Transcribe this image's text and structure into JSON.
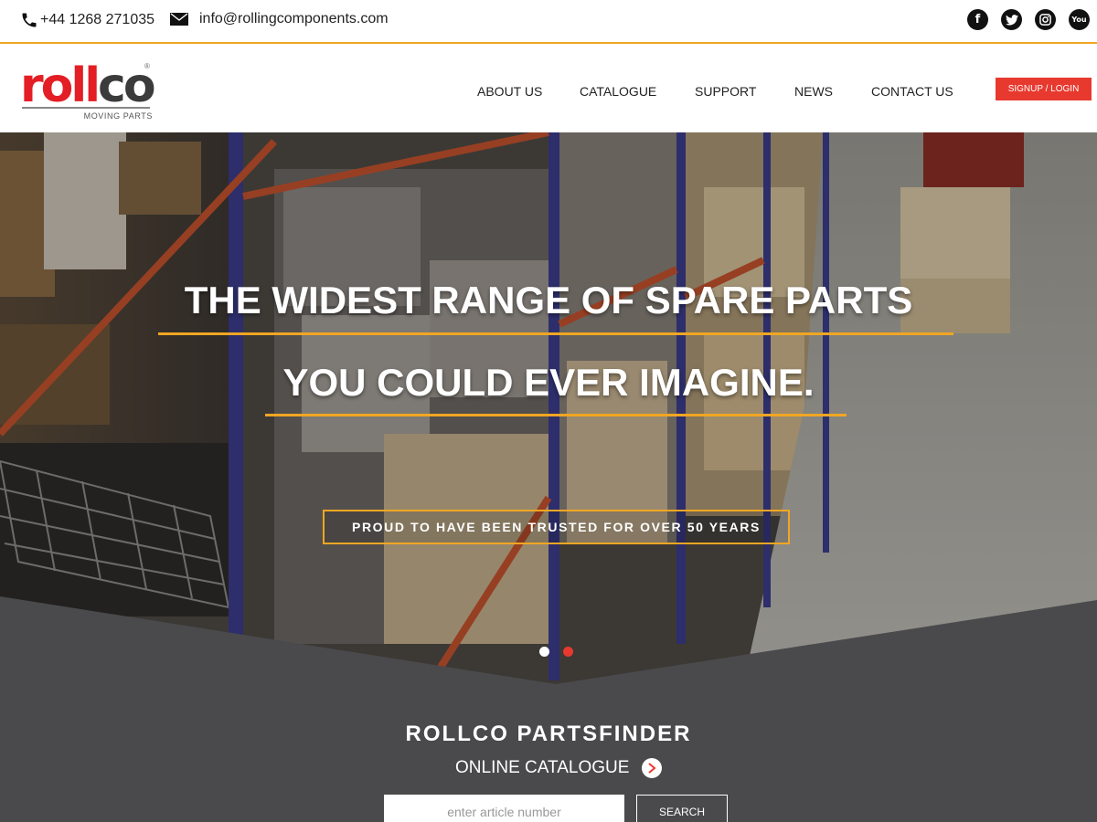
{
  "topbar": {
    "phone": "+44 1268 271035",
    "email": "info@rollingcomponents.com",
    "phone_icon": "phone-icon",
    "email_icon": "envelope-icon",
    "socials": [
      {
        "name": "facebook-icon",
        "glyph": "f"
      },
      {
        "name": "twitter-icon",
        "glyph": ""
      },
      {
        "name": "instagram-icon",
        "glyph": ""
      },
      {
        "name": "youtube-icon",
        "glyph": "You"
      }
    ]
  },
  "header": {
    "logo": {
      "word_red": "roll",
      "word_dark": "co",
      "registered": "®",
      "tagline": "MOVING PARTS"
    },
    "nav": [
      "ABOUT US",
      "CATALOGUE",
      "SUPPORT",
      "NEWS",
      "CONTACT US"
    ],
    "signup_label": "SIGNUP / LOGIN"
  },
  "hero": {
    "headline_1": "THE WIDEST RANGE OF SPARE PARTS",
    "headline_2": "YOU COULD EVER IMAGINE.",
    "trusted": "PROUD TO HAVE BEEN TRUSTED FOR OVER 50 YEARS",
    "slides": {
      "count": 2,
      "active_index": 0
    }
  },
  "partsfinder": {
    "title": "ROLLCO PARTSFINDER",
    "subtitle": "ONLINE CATALOGUE",
    "search_placeholder": "enter article number",
    "search_button": "SEARCH"
  },
  "colors": {
    "accent_orange": "#f0a623",
    "brand_red": "#e31e24",
    "signup_red": "#e8392f",
    "panel_dark": "#4a4a4c"
  }
}
